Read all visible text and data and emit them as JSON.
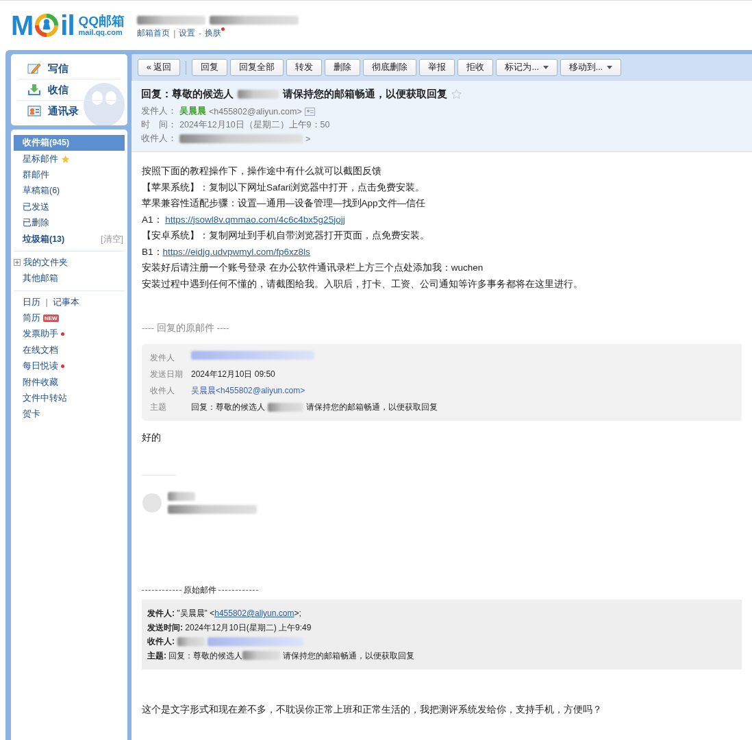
{
  "header": {
    "logo": {
      "prefix": "M",
      "suffix": "il",
      "name": "QQ邮箱",
      "domain": "mail.qq.com"
    },
    "nav": [
      {
        "label": "邮箱首页",
        "dot": false
      },
      {
        "label": "设置",
        "sep": "|",
        "dot": false
      },
      {
        "label": "换肤",
        "sep": "-",
        "dot": true
      }
    ]
  },
  "sidebar": {
    "actions": [
      {
        "label": "写信",
        "kind": "compose"
      },
      {
        "label": "收信",
        "kind": "receive"
      },
      {
        "label": "通讯录",
        "kind": "contacts"
      }
    ],
    "groups": [
      [
        {
          "kind": "plain",
          "label": "收件箱(945)",
          "selected": true,
          "unread": true
        },
        {
          "kind": "star",
          "label": "星标邮件",
          "selected": false,
          "unread": false
        },
        {
          "kind": "plain",
          "label": "群邮件",
          "selected": false,
          "unread": false
        },
        {
          "kind": "plain",
          "label": "草稿箱(6)",
          "selected": false,
          "unread": false
        },
        {
          "kind": "plain",
          "label": "已发送",
          "selected": false,
          "unread": false
        },
        {
          "kind": "plain",
          "label": "已删除",
          "selected": false,
          "unread": false
        },
        {
          "kind": "action",
          "label": "垃圾箱(13)",
          "action": "[清空]",
          "selected": false,
          "unread": true
        }
      ],
      [
        {
          "kind": "expand",
          "label": "我的文件夹",
          "selected": false,
          "unread": false
        },
        {
          "kind": "plain",
          "label": "其他邮箱",
          "selected": false,
          "unread": false
        }
      ],
      [
        {
          "kind": "pair",
          "label": "日历",
          "second": "记事本",
          "separator": "|"
        },
        {
          "kind": "badge",
          "label": "简历",
          "badge": "NEW",
          "selected": false,
          "unread": false
        },
        {
          "kind": "dot",
          "label": "发票助手",
          "selected": false,
          "unread": false
        },
        {
          "kind": "plain",
          "label": "在线文档",
          "selected": false,
          "unread": false
        },
        {
          "kind": "dot",
          "label": "每日悦读",
          "selected": false,
          "unread": false
        },
        {
          "kind": "plain",
          "label": "附件收藏",
          "selected": false,
          "unread": false
        },
        {
          "kind": "plain",
          "label": "文件中转站",
          "selected": false,
          "unread": false
        },
        {
          "kind": "plain",
          "label": "贺卡",
          "selected": false,
          "unread": false
        }
      ]
    ]
  },
  "toolbar": {
    "nav_buttons": [
      {
        "label": "« 返回",
        "dropdown": false
      }
    ],
    "action_buttons": [
      {
        "label": "回复",
        "dropdown": false
      },
      {
        "label": "回复全部",
        "dropdown": false
      },
      {
        "label": "转发",
        "dropdown": false
      },
      {
        "label": "删除",
        "dropdown": false
      },
      {
        "label": "彻底删除",
        "dropdown": false
      },
      {
        "label": "举报",
        "dropdown": false
      },
      {
        "label": "拒收",
        "dropdown": false
      },
      {
        "label": "标记为...",
        "dropdown": true
      },
      {
        "label": "移动到...",
        "dropdown": true
      }
    ]
  },
  "mail": {
    "subject_before": "回复：尊敬的候选人",
    "subject_after": "请保持您的邮箱畅通，以便获取回复",
    "starred": false,
    "from_label": "发件人：",
    "from_name": "吴晨晨",
    "from_address": "<h455802@aliyun.com>",
    "time_label": "时　间：",
    "time": "2024年12月10日（星期二）上午9：50",
    "to_label": "收件人：",
    "to_suffix": ">"
  },
  "body": [
    {
      "text": "按照下面的教程操作下，操作途中有什么就可以截图反馈"
    },
    {
      "text": "【苹果系统】：复制以下网址Safari浏览器中打开，点击免费安装。"
    },
    {
      "text": "苹果兼容性适配步骤：设置—通用—设备管理—找到App文件—信任"
    },
    {
      "text": "A1： ",
      "link": "https://jsowl8v.qmmao.com/4c6c4bx5g25jojj"
    },
    {
      "text": "【安卓系统】：复制网址到手机自带浏览器打开页面，点免费安装。"
    },
    {
      "text": "B1：",
      "link": "https://eidjg.udvpwmyl.com/fp6xz8ls"
    },
    {
      "text": "安装好后请注册一个账号登录 在办公软件通讯录栏上方三个点处添加我：wuchen"
    },
    {
      "text": "安装过程中遇到任何不懂的，请截图给我。入职后，打卡、工资、公司通知等许多事务都将在这里进行。"
    }
  ],
  "quote": {
    "heading": "---- 回复的原邮件 ----",
    "rows": [
      {
        "label": "发件人",
        "kind": "blurred"
      },
      {
        "label": "发送日期",
        "kind": "text",
        "value": "2024年12月10日 09:50"
      },
      {
        "label": "收件人",
        "kind": "link",
        "value": "吴晨晨<h455802@aliyun.com>"
      },
      {
        "label": "主题",
        "kind": "subject",
        "before": "回复：尊敬的候选人",
        "after": "请保持您的邮箱畅通，以便获取回复"
      }
    ]
  },
  "reply": "好的",
  "original": {
    "heading": "原始邮件",
    "rows": [
      {
        "label": "发件人:",
        "kind": "from",
        "before": " \"吴晨晨\" <",
        "link": "h455802@aliyun.com",
        "after": ">;"
      },
      {
        "label": "发送时间:",
        "kind": "text",
        "value": " 2024年12月10日(星期二) 上午9:49"
      },
      {
        "label": "收件人:",
        "kind": "blurred"
      },
      {
        "label": "主题:",
        "kind": "subject",
        "before": " 回复：尊敬的候选人",
        "after": "请保持您的邮箱畅通，以便获取回复"
      }
    ]
  },
  "closing": "这个是文字形式和现在差不多，不耽误你正常上班和正常生活的，我把测评系统发给你，支持手机，方便吗？"
}
